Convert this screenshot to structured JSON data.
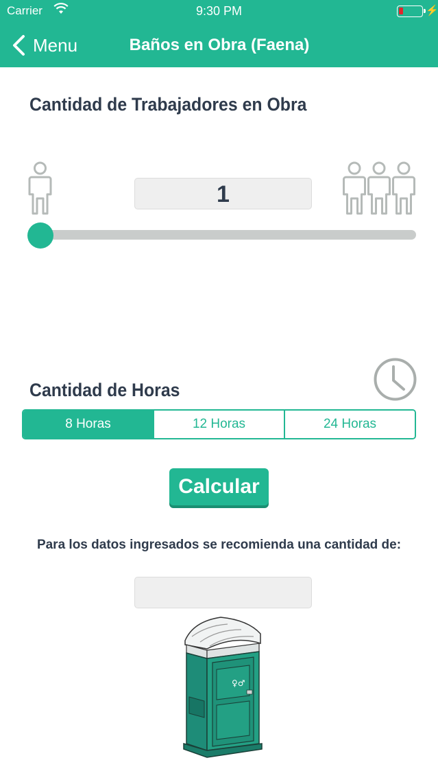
{
  "status_bar": {
    "carrier": "Carrier",
    "time": "9:30 PM",
    "battery_color": "#e0262d"
  },
  "nav": {
    "back_label": "Menu",
    "back_icon": "chevron-left-icon",
    "title": "Baños en Obra (Faena)"
  },
  "workers": {
    "heading": "Cantidad de Trabajadores en Obra",
    "value": "1",
    "slider_level": 0.0,
    "min_icon": "single-person-icon",
    "max_icon": "group-people-icon"
  },
  "hours": {
    "heading": "Cantidad de Horas",
    "icon": "clock-icon",
    "options": [
      "8 Horas",
      "12 Horas",
      "24 Horas"
    ],
    "selected": "8 Horas"
  },
  "calculate_button": "Calcular",
  "result": {
    "label": "Para los datos ingresados se recomienda una cantidad de:",
    "value": ""
  },
  "colors": {
    "accent": "#22b793",
    "heading_text": "#2f3b4c",
    "track": "#c9cccb"
  }
}
